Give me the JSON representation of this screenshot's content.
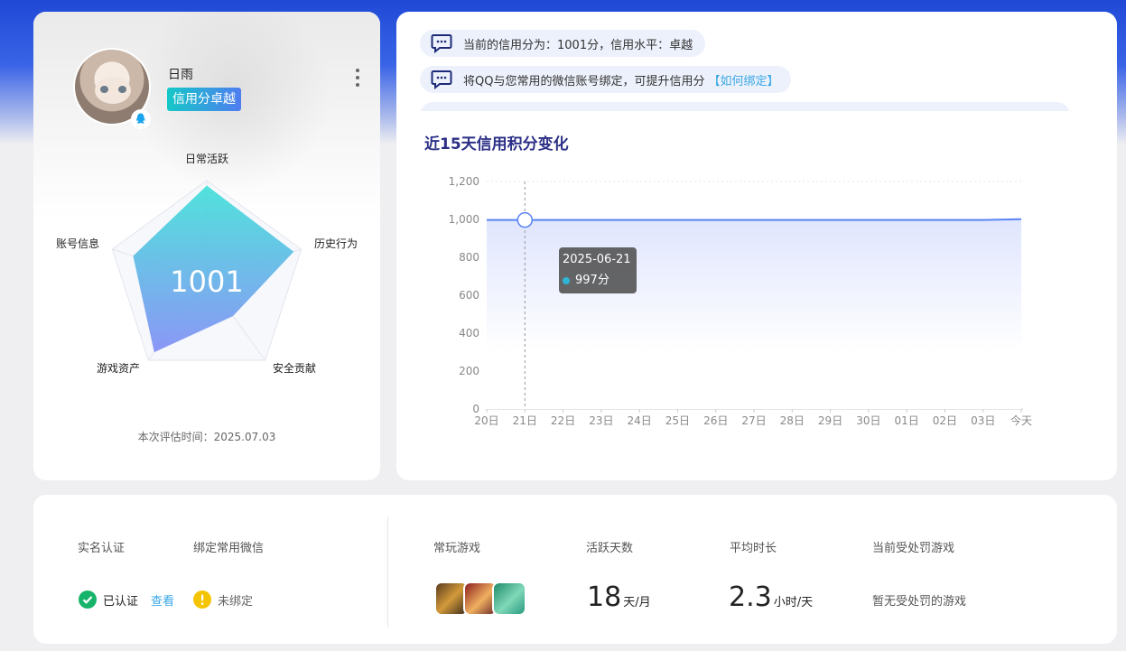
{
  "profile": {
    "nickname": "日雨",
    "credit_badge": "信用分卓越",
    "score": "1001",
    "radar_labels": [
      "日常活跃",
      "历史行为",
      "安全贡献",
      "游戏资产",
      "账号信息"
    ],
    "radar_values": [
      0.95,
      0.92,
      0.45,
      0.9,
      0.78
    ],
    "eval_time": "本次评估时间：2025.07.03"
  },
  "notices": {
    "n1": "当前的信用分为：1001分，信用水平：卓越",
    "n2": "将QQ与您常用的微信账号绑定，可提升信用分",
    "n2_link": "【如何绑定】"
  },
  "chart_title": "近15天信用积分变化",
  "chart_data": {
    "type": "area",
    "categories": [
      "20日",
      "21日",
      "22日",
      "23日",
      "24日",
      "25日",
      "26日",
      "27日",
      "28日",
      "29日",
      "30日",
      "01日",
      "02日",
      "03日",
      "今天"
    ],
    "values": [
      997,
      997,
      997,
      997,
      997,
      997,
      997,
      997,
      997,
      997,
      997,
      997,
      997,
      997,
      1001
    ],
    "ylim": [
      0,
      1200
    ],
    "yticks": [
      "0",
      "200",
      "400",
      "600",
      "800",
      "1,000",
      "1,200"
    ],
    "grid": true,
    "colors": {
      "line": "#5b83f5",
      "fill_top": "#dfe5fd"
    }
  },
  "tooltip": {
    "date": "2025-06-21",
    "value": "997分"
  },
  "stats": {
    "realname_label": "实名认证",
    "wechat_label": "绑定常用微信",
    "realname_status": "已认证",
    "view_link": "查看",
    "wechat_status": "未绑定",
    "games_label": "常玩游戏",
    "active_days_label": "活跃天数",
    "active_days_value": "18",
    "active_days_unit": "天/月",
    "avg_time_label": "平均时长",
    "avg_time_value": "2.3",
    "avg_time_unit": "小时/天",
    "penalty_label": "当前受处罚游戏",
    "penalty_value": "暂无受处罚的游戏"
  }
}
